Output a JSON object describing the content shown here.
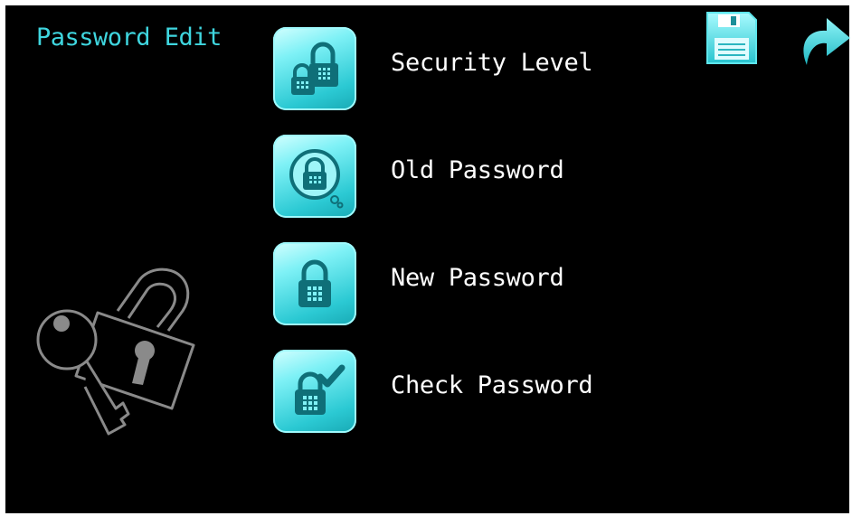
{
  "header": {
    "title": "Password Edit"
  },
  "toolbar": {
    "save_icon": "floppy-disk-icon",
    "redo_icon": "redo-arrow-icon"
  },
  "menu": {
    "items": [
      {
        "label": "Security Level",
        "icon": "double-lock-icon"
      },
      {
        "label": "Old Password",
        "icon": "lock-in-bubble-icon"
      },
      {
        "label": "New Password",
        "icon": "lock-icon"
      },
      {
        "label": "Check Password",
        "icon": "lock-check-icon"
      }
    ]
  },
  "illustration": {
    "icon": "key-and-padlock-icon"
  },
  "colors": {
    "accent": "#3fd6df",
    "background": "#000000",
    "text": "#ffffff",
    "icon_dark": "#0f6f78"
  }
}
